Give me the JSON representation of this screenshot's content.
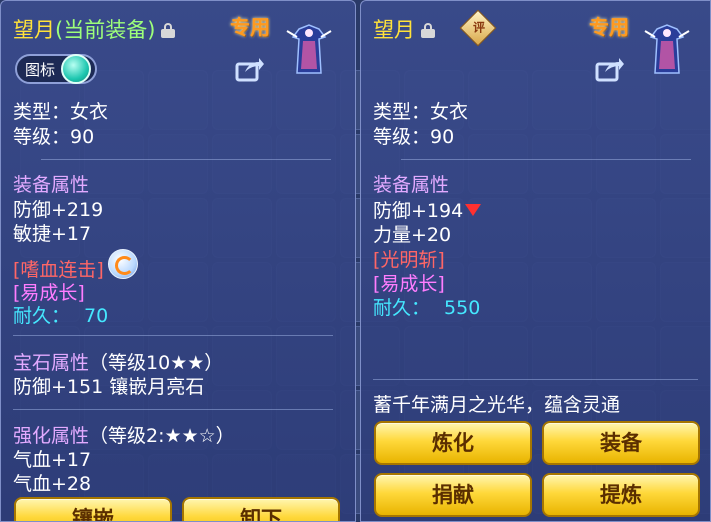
{
  "left_panel": {
    "title_name": "望月",
    "title_status": "(当前装备)",
    "special_label": "专用",
    "toggle_label": "图标",
    "type_line": "类型：女衣",
    "level_line": "等级：90",
    "equip_attr_header": "装备属性",
    "attrs": [
      "防御+219",
      "敏捷+17"
    ],
    "skill_red": "[嗜血连击]",
    "skill_pink": "[易成长]",
    "durability_label": "耐久：",
    "durability_value": "70",
    "gem_header": "宝石属性",
    "gem_level": "（等级10★★）",
    "gem_line": "防御+151 镶嵌月亮石",
    "enhance_header": "强化属性",
    "enhance_level": "（等级2:★★☆）",
    "enhance_lines": [
      "气血+17",
      "气血+28"
    ],
    "buttons": [
      "镶嵌",
      "卸下"
    ]
  },
  "right_panel": {
    "title_name": "望月",
    "rating_label": "评",
    "special_label": "专用",
    "type_line": "类型：女衣",
    "level_line": "等级：90",
    "equip_attr_header": "装备属性",
    "attrs": [
      "防御+194",
      "力量+20"
    ],
    "skill_red": "[光明斩]",
    "skill_pink": "[易成长]",
    "durability_label": "耐久：",
    "durability_value": "550",
    "description": "蓄千年满月之光华，蕴含灵通",
    "buttons": [
      "炼化",
      "装备",
      "捐献",
      "提炼"
    ]
  },
  "colors": {
    "title": "#ffe23a",
    "section": "#e2aaff",
    "red_skill": "#ff6666",
    "pink_skill": "#ff7dff",
    "durability": "#45e8ff",
    "button": "#ffd83a"
  },
  "icons": {
    "lock": "unlock-icon",
    "share": "share-icon",
    "item": "robe-item-icon",
    "refresh": "refresh-icon",
    "arrow": "decrease-arrow-icon",
    "rating": "rating-badge-icon"
  }
}
